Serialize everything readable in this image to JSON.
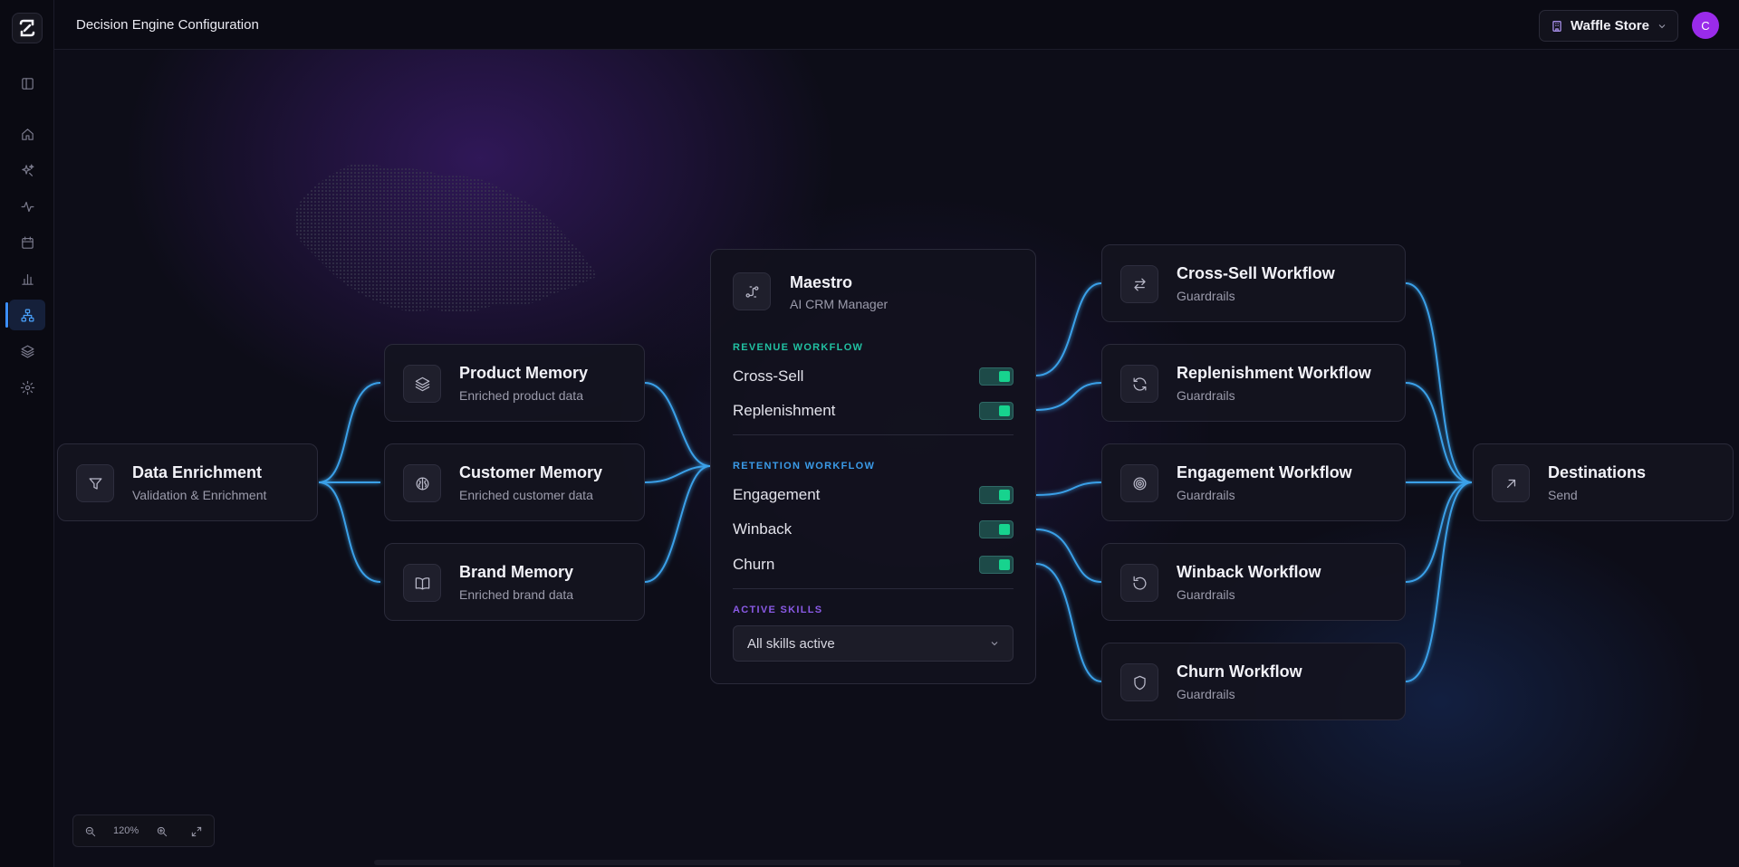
{
  "header": {
    "title": "Decision Engine Configuration",
    "store": "Waffle Store",
    "avatar_initial": "C"
  },
  "sidebar": {
    "items": [
      {
        "icon": "panel-toggle-icon"
      },
      {
        "icon": "home-icon"
      },
      {
        "icon": "sparkles-icon"
      },
      {
        "icon": "activity-icon"
      },
      {
        "icon": "calendar-icon"
      },
      {
        "icon": "bar-chart-icon"
      },
      {
        "icon": "network-icon",
        "active": true
      },
      {
        "icon": "layers-icon"
      },
      {
        "icon": "settings-icon"
      }
    ]
  },
  "nodes": {
    "data_enrichment": {
      "title": "Data Enrichment",
      "sub": "Validation & Enrichment"
    },
    "product_memory": {
      "title": "Product Memory",
      "sub": "Enriched product data"
    },
    "customer_memory": {
      "title": "Customer Memory",
      "sub": "Enriched customer data"
    },
    "brand_memory": {
      "title": "Brand Memory",
      "sub": "Enriched brand data"
    },
    "cross_sell": {
      "title": "Cross-Sell Workflow",
      "sub": "Guardrails"
    },
    "replenishment": {
      "title": "Replenishment Workflow",
      "sub": "Guardrails"
    },
    "engagement": {
      "title": "Engagement Workflow",
      "sub": "Guardrails"
    },
    "winback": {
      "title": "Winback Workflow",
      "sub": "Guardrails"
    },
    "churn": {
      "title": "Churn Workflow",
      "sub": "Guardrails"
    },
    "destinations": {
      "title": "Destinations",
      "sub": "Send"
    }
  },
  "maestro": {
    "title": "Maestro",
    "sub": "AI CRM Manager",
    "revenue_label": "REVENUE WORKFLOW",
    "retention_label": "RETENTION WORKFLOW",
    "skills_label": "ACTIVE SKILLS",
    "toggles": {
      "cross_sell": {
        "label": "Cross-Sell",
        "on": true
      },
      "replenishment": {
        "label": "Replenishment",
        "on": true
      },
      "engagement": {
        "label": "Engagement",
        "on": true
      },
      "winback": {
        "label": "Winback",
        "on": true
      },
      "churn": {
        "label": "Churn",
        "on": true
      }
    },
    "skills_value": "All skills active"
  },
  "zoom": {
    "value": "120%"
  },
  "colors": {
    "wire": "#3aa0e8",
    "toggle_on": "#17d38e",
    "revenue_label": "#21c1a2",
    "retention_label": "#3a9be8",
    "skills_label": "#8a5ae6",
    "avatar": "#9a2bea",
    "accent": "#3b8eff"
  }
}
